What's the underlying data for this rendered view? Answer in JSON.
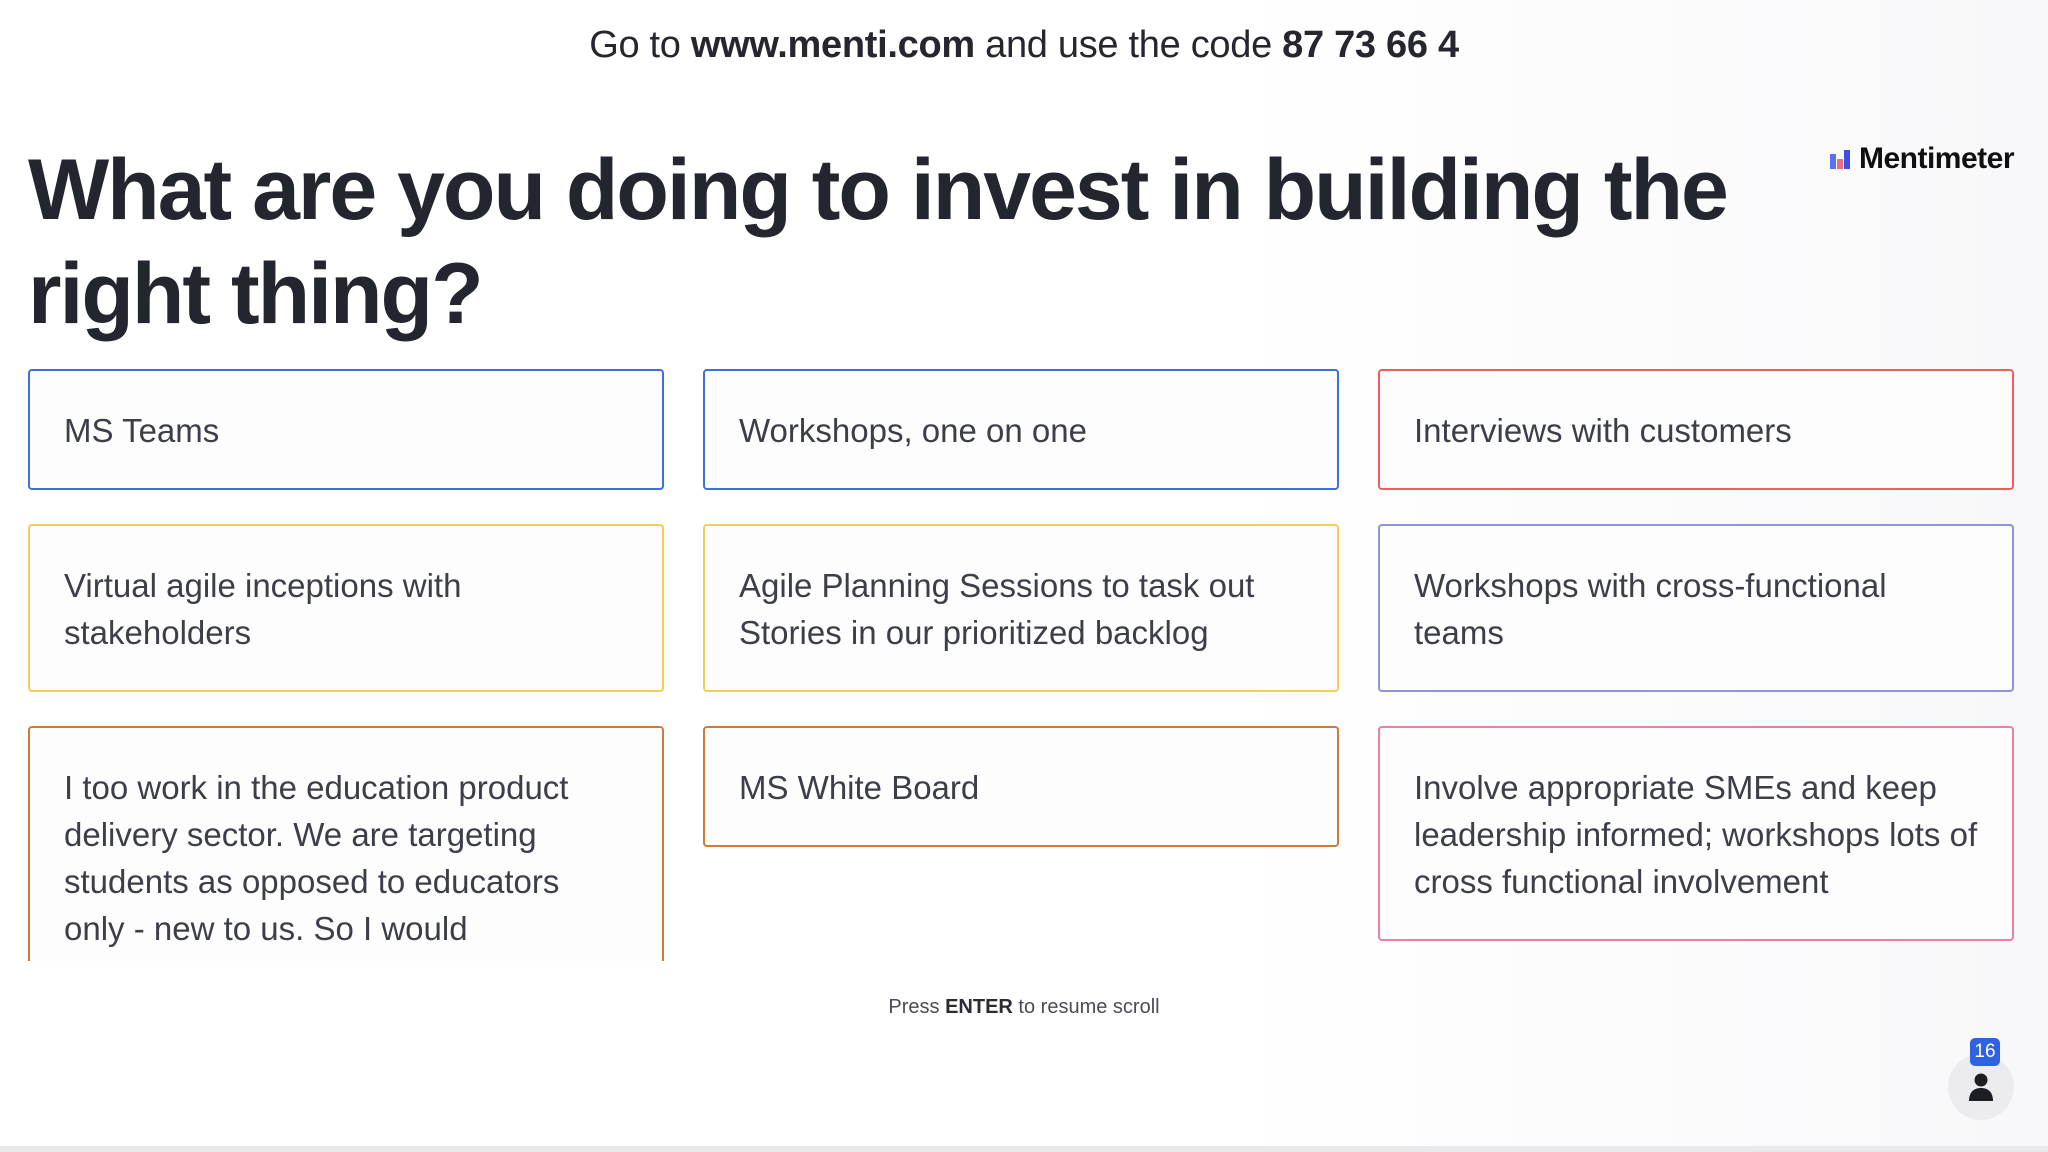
{
  "join": {
    "prefix": "Go to ",
    "url": "www.menti.com",
    "middle": " and use the code ",
    "code": "87 73 66 4"
  },
  "brand": {
    "name": "Mentimeter",
    "logo_icon": "mentimeter-logo-icon"
  },
  "question": "What are you doing to invest in building the right thing?",
  "columns": [
    [
      {
        "text": "MS Teams",
        "color": "#3f6fd8"
      },
      {
        "text": "Virtual agile inceptions with stakeholders",
        "color": "#f2cd5a"
      },
      {
        "text": "I too work in the education product delivery sector. We are targeting students as opposed to educators only - new to us. So I would",
        "color": "#cf7a38"
      }
    ],
    [
      {
        "text": "Workshops, one on one",
        "color": "#3f6fd8"
      },
      {
        "text": "Agile Planning Sessions to task out Stories in our prioritized backlog",
        "color": "#f2cd5a"
      },
      {
        "text": "MS White Board",
        "color": "#cf7a38"
      }
    ],
    [
      {
        "text": "Interviews with customers",
        "color": "#ef5d5d"
      },
      {
        "text": "Workshops with cross-functional teams",
        "color": "#8f96d8"
      },
      {
        "text": "Involve appropriate SMEs and keep leadership informed; workshops lots of cross functional involvement",
        "color": "#ec7fa3"
      }
    ]
  ],
  "hint": {
    "prefix": "Press ",
    "key": "ENTER",
    "suffix": " to resume scroll"
  },
  "participants": {
    "count": "16",
    "icon": "person-icon"
  }
}
